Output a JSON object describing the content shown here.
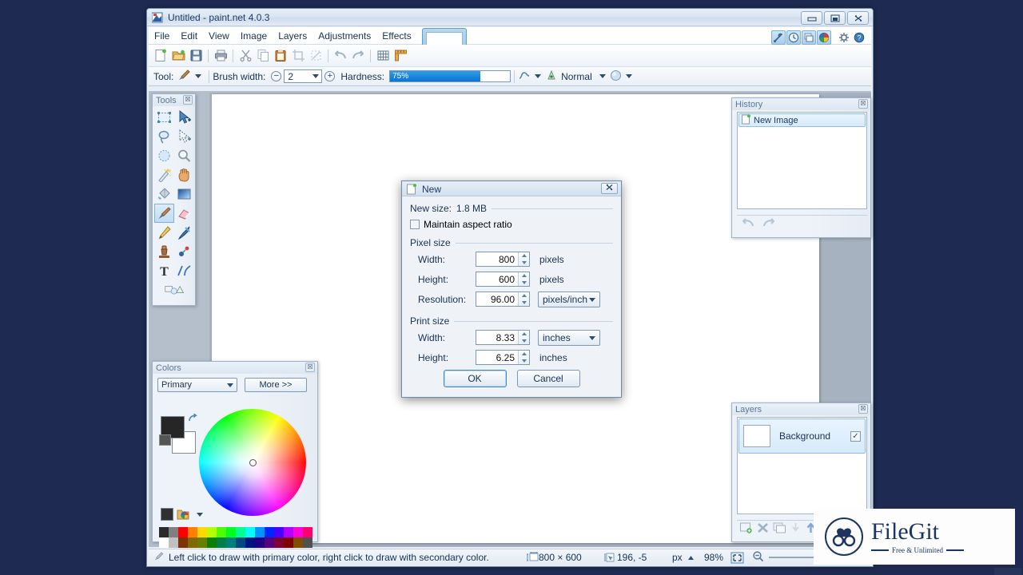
{
  "window": {
    "title": "Untitled - paint.net 4.0.3",
    "title_icon": "paintnet-logo-icon",
    "controls": {
      "minimize": "–",
      "maximize": "□",
      "close": "✕"
    }
  },
  "menu": {
    "items": [
      {
        "label": "File"
      },
      {
        "label": "Edit"
      },
      {
        "label": "View"
      },
      {
        "label": "Image"
      },
      {
        "label": "Layers"
      },
      {
        "label": "Adjustments"
      },
      {
        "label": "Effects"
      }
    ]
  },
  "panel_toggles": [
    {
      "name": "tools-toggle",
      "icon": "wrench-icon",
      "active": true
    },
    {
      "name": "history-toggle",
      "icon": "clock-icon",
      "active": true
    },
    {
      "name": "layers-toggle",
      "icon": "layers-icon",
      "active": true
    },
    {
      "name": "colors-toggle",
      "icon": "color-wheel-icon",
      "active": true
    },
    {
      "name": "settings-button",
      "icon": "gear-icon",
      "active": false
    },
    {
      "name": "help-button",
      "icon": "help-icon",
      "active": false
    }
  ],
  "toolbar": {
    "buttons": [
      {
        "name": "new-image",
        "icon": "new-document-icon"
      },
      {
        "name": "open-image",
        "icon": "open-folder-icon"
      },
      {
        "name": "save-image",
        "icon": "save-disk-icon"
      },
      {
        "name": "print-image",
        "icon": "printer-icon"
      },
      {
        "name": "cut",
        "icon": "scissors-icon"
      },
      {
        "name": "copy",
        "icon": "copy-pages-icon"
      },
      {
        "name": "paste",
        "icon": "clipboard-paste-icon"
      },
      {
        "name": "crop-to-selection",
        "icon": "crop-icon"
      },
      {
        "name": "deselect-all",
        "icon": "deselect-icon"
      },
      {
        "name": "undo",
        "icon": "undo-arrow-icon"
      },
      {
        "name": "redo",
        "icon": "redo-arrow-icon"
      },
      {
        "name": "toggle-grid",
        "icon": "grid-icon"
      },
      {
        "name": "toggle-rulers",
        "icon": "ruler-icon"
      }
    ]
  },
  "tool_options": {
    "tool_label": "Tool:",
    "tool_icon": "paintbrush-icon",
    "brush_width_label": "Brush width:",
    "brush_width_value": "2",
    "decrease_icon": "minus-circle-icon",
    "increase_icon": "plus-circle-icon",
    "hardness_label": "Hardness:",
    "hardness_value": "75%",
    "hardness_percent": 75,
    "hardness_fill_color": "#0a76cf",
    "smoothing_icon": "curve-icon",
    "blend_mode_icon": "antialiasing-icon",
    "blend_mode_label": "Normal",
    "blending_icon": "blend-sphere-icon"
  },
  "tools_panel": {
    "title": "Tools",
    "close_icon": "close-icon",
    "tools": [
      {
        "name": "rectangle-select-tool",
        "icon": "dashed-rectangle-icon",
        "selected": false
      },
      {
        "name": "move-selected-tool",
        "icon": "move-cursor-icon",
        "selected": false
      },
      {
        "name": "lasso-select-tool",
        "icon": "lasso-icon",
        "selected": false
      },
      {
        "name": "move-selection-tool",
        "icon": "move-selection-icon",
        "selected": false
      },
      {
        "name": "ellipse-select-tool",
        "icon": "dashed-ellipse-icon",
        "selected": false
      },
      {
        "name": "zoom-tool",
        "icon": "magnifier-icon",
        "selected": false
      },
      {
        "name": "magic-wand-tool",
        "icon": "magic-wand-icon",
        "selected": false
      },
      {
        "name": "pan-tool",
        "icon": "hand-icon",
        "selected": false
      },
      {
        "name": "paint-bucket-tool",
        "icon": "paint-bucket-icon",
        "selected": false
      },
      {
        "name": "gradient-tool",
        "icon": "gradient-icon",
        "selected": false
      },
      {
        "name": "paintbrush-tool",
        "icon": "paintbrush-icon",
        "selected": true
      },
      {
        "name": "eraser-tool",
        "icon": "eraser-icon",
        "selected": false
      },
      {
        "name": "pencil-tool",
        "icon": "pencil-icon",
        "selected": false
      },
      {
        "name": "color-picker-tool",
        "icon": "eyedropper-icon",
        "selected": false
      },
      {
        "name": "clone-stamp-tool",
        "icon": "stamp-icon",
        "selected": false
      },
      {
        "name": "recolor-tool",
        "icon": "recolor-icon",
        "selected": false
      },
      {
        "name": "text-tool",
        "icon": "text-t-icon",
        "selected": false
      },
      {
        "name": "line-curve-tool",
        "icon": "line-curve-icon",
        "selected": false
      },
      {
        "name": "shapes-tool",
        "icon": "shapes-icon",
        "selected": false
      }
    ]
  },
  "colors_panel": {
    "title": "Colors",
    "close_icon": "close-icon",
    "mode_value": "Primary",
    "more_label": "More >>",
    "primary_color": "#262626",
    "secondary_color": "#ffffff",
    "swap_icon": "swap-arrow-icon",
    "reset_icon": "reset-colors-icon",
    "palette_button_icon": "palette-icon",
    "palette_row_top": [
      "#2b2b2b",
      "#808080",
      "#ff0000",
      "#ff7f00",
      "#ffd800",
      "#b6ff00",
      "#4cff00",
      "#00ff21",
      "#00ff90",
      "#00ffff",
      "#0094ff",
      "#0026ff",
      "#4800ff",
      "#b200ff",
      "#ff00dc",
      "#ff006e"
    ],
    "palette_row_bottom": [
      "#ffffff",
      "#c0c0c0",
      "#7f3300",
      "#7f6a00",
      "#667f00",
      "#0b7f00",
      "#007f46",
      "#007f7f",
      "#00497f",
      "#00137f",
      "#21007f",
      "#57007f",
      "#7f0037",
      "#7f0000",
      "#7f4f00",
      "#505050"
    ]
  },
  "history_panel": {
    "title": "History",
    "close_icon": "close-icon",
    "items": [
      {
        "label": "New Image",
        "icon": "new-image-icon",
        "selected": true
      }
    ],
    "undo_icon": "undo-arrow-icon",
    "redo_icon": "redo-arrow-icon"
  },
  "layers_panel": {
    "title": "Layers",
    "close_icon": "close-icon",
    "layers": [
      {
        "name": "Background",
        "visible": true,
        "check_glyph": "✓"
      }
    ],
    "footer_buttons": [
      {
        "name": "add-layer-button",
        "icon": "add-layer-icon"
      },
      {
        "name": "delete-layer-button",
        "icon": "delete-layer-icon"
      },
      {
        "name": "duplicate-layer-button",
        "icon": "duplicate-layer-icon"
      },
      {
        "name": "merge-layer-down-button",
        "icon": "merge-down-icon"
      },
      {
        "name": "move-layer-up-button",
        "icon": "arrow-up-icon"
      },
      {
        "name": "move-layer-down-button",
        "icon": "arrow-down-icon"
      },
      {
        "name": "layer-properties-button",
        "icon": "properties-icon"
      }
    ]
  },
  "status_bar": {
    "help_icon": "paintbrush-icon",
    "help_text": "Left click to draw with primary color, right click to draw with secondary color.",
    "image_size_icon": "image-size-icon",
    "image_size": "800 × 600",
    "cursor_icon": "cursor-position-icon",
    "cursor_position": "196, -5",
    "unit": "px",
    "unit_caret_icon": "caret-up-icon",
    "zoom_level": "98%",
    "fit_icon": "fit-to-window-icon",
    "zoom_out_icon": "zoom-out-icon",
    "zoom_in_icon": "zoom-in-icon",
    "zoom_slider_percent": 55
  },
  "new_dialog": {
    "title": "New",
    "title_icon": "new-document-icon",
    "close_glyph": "✕",
    "new_size_label": "New size:",
    "new_size_value": "1.8 MB",
    "maintain_aspect_label": "Maintain aspect ratio",
    "maintain_aspect_checked": false,
    "pixel_size_group": "Pixel size",
    "print_size_group": "Print size",
    "fields": {
      "pixel_width_label": "Width:",
      "pixel_width_value": "800",
      "pixel_width_unit": "pixels",
      "pixel_height_label": "Height:",
      "pixel_height_value": "600",
      "pixel_height_unit": "pixels",
      "resolution_label": "Resolution:",
      "resolution_value": "96.00",
      "resolution_unit": "pixels/inch",
      "print_width_label": "Width:",
      "print_width_value": "8.33",
      "print_width_unit": "inches",
      "print_height_label": "Height:",
      "print_height_value": "6.25",
      "print_height_unit": "inches"
    },
    "ok_label": "OK",
    "cancel_label": "Cancel"
  },
  "watermark": {
    "name": "FileGit",
    "tagline": "Free & Unlimited",
    "logo_icon": "binoculars-logo-icon",
    "accent_color": "#1d3461"
  },
  "desktop": {
    "background_color": "#1e2a52"
  }
}
